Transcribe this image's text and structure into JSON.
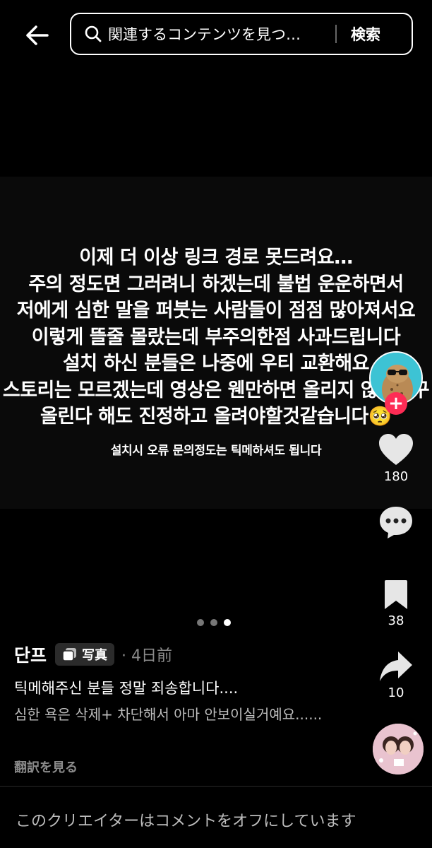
{
  "search": {
    "placeholder": "関連するコンテンツを見つ…",
    "button_label": "検索"
  },
  "post_image": {
    "lines": [
      "이제 더 이상 링크 경로 못드려요…",
      "주의 정도면 그러려니 하겠는데 불법 운운하면서",
      "저에게 심한 말을 퍼붓는 사람들이 점점 많아져서요",
      "이렇게 뜰줄 몰랐는데 부주의한점 사과드립니다",
      "설치 하신 분들은 나중에 우티 교환해요",
      "스토리는 모르겠는데 영상은 웬만하면 올리지 않으려구",
      "올린다 해도 진정하고 올려야할것같습니다🥺"
    ],
    "small_line": "설치시 오류 문의정도는 틱메하셔도 됩니다"
  },
  "actions": {
    "likes": "180",
    "bookmarks": "38",
    "shares": "10"
  },
  "post": {
    "author": "단프",
    "type_badge": "写真",
    "date": "· 4日前",
    "caption": "틱메해주신 분들 정말 죄송합니다....",
    "caption_sub": "심한 욕은 삭제+ 차단해서 아마 안보이실거예요......",
    "translate_label": "翻訳を見る"
  },
  "footer": {
    "comments_disabled": "このクリエイターはコメントをオフにしています"
  },
  "colors": {
    "background": "#000000",
    "follow_accent": "#fe2c55",
    "avatar_bg": "#3dc3d4"
  },
  "icons": [
    "back-arrow-icon",
    "search-icon",
    "plus-icon",
    "heart-icon",
    "comment-icon",
    "bookmark-icon",
    "share-icon",
    "photo-icon"
  ]
}
